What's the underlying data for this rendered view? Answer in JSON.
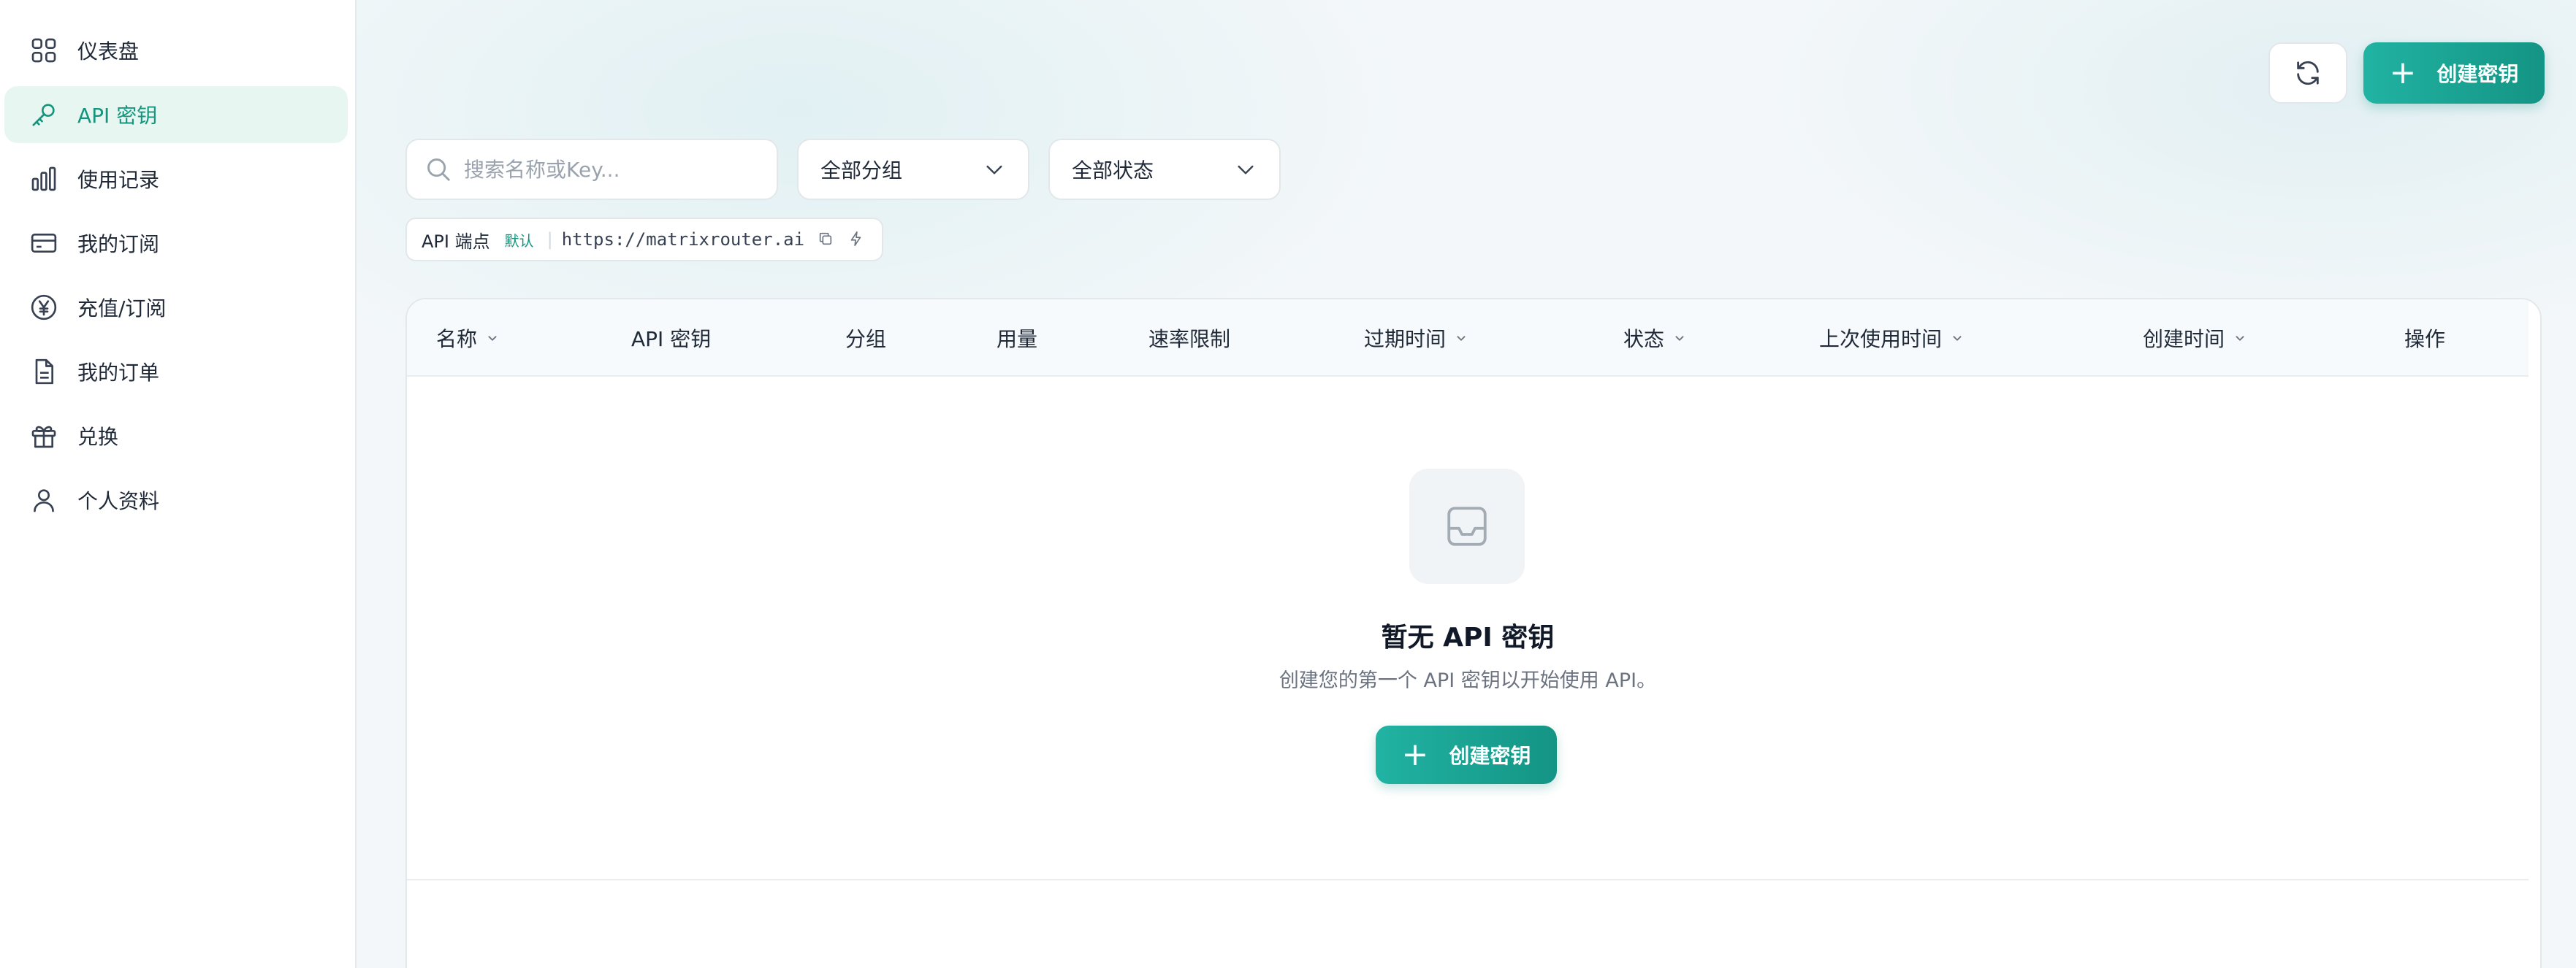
{
  "sidebar": {
    "items": [
      {
        "label": "仪表盘",
        "icon": "grid-icon"
      },
      {
        "label": "API 密钥",
        "icon": "key-icon",
        "active": true
      },
      {
        "label": "使用记录",
        "icon": "bar-chart-icon"
      },
      {
        "label": "我的订阅",
        "icon": "credit-card-icon"
      },
      {
        "label": "充值/订阅",
        "icon": "yen-circle-icon"
      },
      {
        "label": "我的订单",
        "icon": "document-icon"
      },
      {
        "label": "兑换",
        "icon": "gift-icon"
      },
      {
        "label": "个人资料",
        "icon": "user-icon"
      }
    ]
  },
  "toolbar": {
    "create_label": "创建密钥"
  },
  "filters": {
    "search_placeholder": "搜索名称或Key...",
    "group_select": "全部分组",
    "status_select": "全部状态"
  },
  "endpoint": {
    "label": "API 端点",
    "badge": "默认",
    "url": "https://matrixrouter.ai"
  },
  "table": {
    "columns": [
      {
        "label": "名称",
        "sortable": true
      },
      {
        "label": "API 密钥",
        "sortable": false
      },
      {
        "label": "分组",
        "sortable": false
      },
      {
        "label": "用量",
        "sortable": false
      },
      {
        "label": "速率限制",
        "sortable": false
      },
      {
        "label": "过期时间",
        "sortable": true
      },
      {
        "label": "状态",
        "sortable": true
      },
      {
        "label": "上次使用时间",
        "sortable": true
      },
      {
        "label": "创建时间",
        "sortable": true
      },
      {
        "label": "操作",
        "sortable": false
      }
    ],
    "rows": []
  },
  "empty_state": {
    "title": "暂无 API 密钥",
    "description": "创建您的第一个 API 密钥以开始使用 API。",
    "button_label": "创建密钥"
  },
  "colors": {
    "accent": "#14967e",
    "accent_light": "#21b3a3",
    "active_bg": "#e8f6f2"
  }
}
